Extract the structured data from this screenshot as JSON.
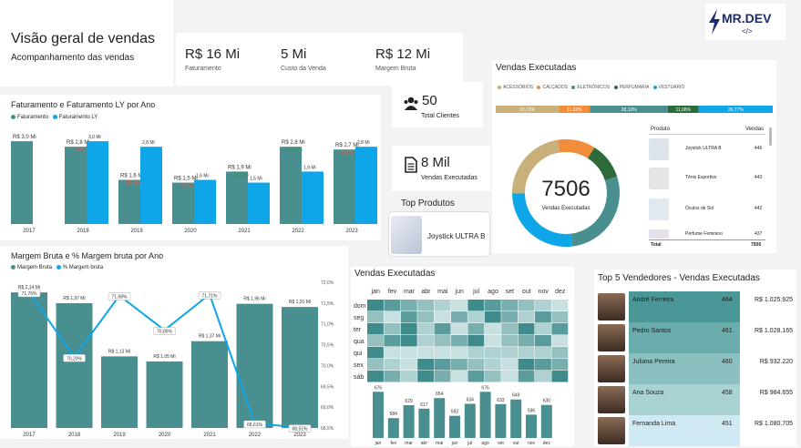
{
  "header": {
    "title": "Visão geral de vendas",
    "subtitle": "Acompanhamento das vendas",
    "logo_text": "MR.DEV",
    "logo_sub": "</>"
  },
  "kpis": [
    {
      "value": "R$ 16 Mi",
      "label": "Faturamento"
    },
    {
      "value": "5 Mi",
      "label": "Custo da Venda"
    },
    {
      "value": "R$ 12 Mi",
      "label": "Margem Bruta"
    }
  ],
  "clients": {
    "value": "50",
    "label": "Total Clientes",
    "icon": "people-icon"
  },
  "sales_kpi": {
    "value": "8 Mil",
    "label": "Vendas Executadas",
    "icon": "document-icon"
  },
  "top_product": {
    "title": "Top Produtos",
    "name": "Joystick ULTRA B"
  },
  "colors": {
    "teal": "#4a8f8f",
    "blue": "#0ea5e9",
    "red": "#e05a47",
    "green": "#2e9e4f",
    "tan": "#c9b07a",
    "orange": "#f18d3b",
    "darkgreen": "#2e6b3a",
    "cyan": "#17a2d6"
  },
  "revenue_chart": {
    "title": "Faturamento e Faturamento LY por Ano",
    "legend": [
      "Faturamento",
      "Faturamento LY"
    ],
    "chart_data": {
      "type": "bar",
      "categories": [
        "2017",
        "2018",
        "2019",
        "2020",
        "2021",
        "2022",
        "2023"
      ],
      "series": [
        {
          "name": "Faturamento",
          "values": [
            3.0,
            2.8,
            1.6,
            1.5,
            1.9,
            2.8,
            2.7
          ],
          "labels": [
            "R$ 3,0 Mi",
            "R$ 2,8 Mi",
            "R$ 1,6 Mi",
            "R$ 1,5 Mi",
            "R$ 1,9 Mi",
            "R$ 2,8 Mi",
            "R$ 2,7 Mi"
          ]
        },
        {
          "name": "Faturamento LY",
          "values": [
            null,
            3.0,
            2.8,
            1.6,
            1.5,
            1.9,
            2.8
          ],
          "labels": [
            "",
            "3,0 Mi",
            "2,8 Mi",
            "1,6 Mi",
            "1,5 Mi",
            "1,9 Mi",
            "2,8 Mi"
          ]
        }
      ],
      "pct_labels": [
        "",
        "6,6%",
        "45,9%",
        "5,6%",
        "28,1%",
        "47,4%",
        "2,1%"
      ],
      "pct_colors": [
        "",
        "#e05a47",
        "#e05a47",
        "#e05a47",
        "#2e9e4f",
        "#2e9e4f",
        "#e05a47"
      ],
      "ylim": [
        0,
        3.3
      ]
    }
  },
  "margin_chart": {
    "title": "Margem Bruta e % Margem bruta por Ano",
    "legend": [
      "Margem Bruta",
      "% Margem bruta"
    ],
    "chart_data": {
      "type": "bar",
      "categories": [
        "2017",
        "2018",
        "2019",
        "2020",
        "2021",
        "2022",
        "2023"
      ],
      "series": [
        {
          "name": "Margem Bruta",
          "values": [
            2.14,
            1.97,
            1.13,
            1.05,
            1.37,
            1.96,
            1.91
          ],
          "labels": [
            "R$ 2,14 Mi",
            "R$ 1,97 Mi",
            "R$ 1,13 Mi",
            "R$ 1,05 Mi",
            "R$ 1,37 Mi",
            "R$ 1,96 Mi",
            "R$ 1,91 Mi"
          ]
        },
        {
          "name": "% Margem bruta",
          "values": [
            71.76,
            70.2,
            71.68,
            70.85,
            71.71,
            68.61,
            68.51
          ],
          "labels": [
            "71,76%",
            "70,20%",
            "71,68%",
            "70,85%",
            "71,71%",
            "68,61%",
            "68,51%"
          ]
        }
      ],
      "y2_ticks": [
        "72,0%",
        "71,5%",
        "71,0%",
        "70,5%",
        "70,0%",
        "69,5%",
        "69,0%",
        "68,5%"
      ],
      "y2lim": [
        68.5,
        72.0
      ],
      "ylim": [
        0,
        2.3
      ]
    }
  },
  "donut": {
    "title": "Vendas Executadas",
    "center_value": "7506",
    "center_label": "Vendas Executadas",
    "legend": [
      "ACESSÓRIOS",
      "CALÇADOS",
      "ELETRÔNICOS",
      "PERFUMARIA",
      "VESTUÁRIO"
    ],
    "chart_data": {
      "type": "pie",
      "categories": [
        "ACESSÓRIOS",
        "CALÇADOS",
        "ELETRÔNICOS",
        "PERFUMARIA",
        "VESTUÁRIO"
      ],
      "values": [
        22.73,
        11.32,
        28.1,
        11.08,
        26.77
      ],
      "labels": [
        "22,73%",
        "11,32%",
        "28,10%",
        "11,08%",
        "26,77%"
      ],
      "colors": [
        "#c9b07a",
        "#f18d3b",
        "#4a8f8f",
        "#2e6b3a",
        "#0ea5e9"
      ]
    },
    "table": {
      "headers": [
        "Produto",
        "Vendas"
      ],
      "rows": [
        {
          "name": "Joystick ULTRA B",
          "value": "446"
        },
        {
          "name": "Tênis Esportivo",
          "value": "443"
        },
        {
          "name": "Óculos de Sol",
          "value": "442"
        },
        {
          "name": "Perfume Feminino",
          "value": "437"
        }
      ],
      "total_label": "Total",
      "total_value": "7506"
    }
  },
  "heatmap": {
    "title": "Vendas Executadas",
    "months": [
      "jan",
      "fev",
      "mar",
      "abr",
      "mai",
      "jun",
      "jul",
      "ago",
      "set",
      "out",
      "nov",
      "dez"
    ],
    "days": [
      "dom",
      "seg",
      "ter",
      "qua",
      "qui",
      "sex",
      "sáb"
    ],
    "chart_data": {
      "type": "bar",
      "categories": [
        "jan",
        "fev",
        "mar",
        "abr",
        "mai",
        "jun",
        "jul",
        "ago",
        "set",
        "out",
        "nov",
        "dez"
      ],
      "values": [
        676,
        584,
        629,
        617,
        654,
        592,
        634,
        676,
        633,
        649,
        596,
        630
      ]
    }
  },
  "sellers": {
    "title": "Top 5 Vendedores - Vendas Executadas",
    "rows": [
      {
        "name": "André Ferreira",
        "sales": "464",
        "value": "R$ 1.025.925"
      },
      {
        "name": "Pedro Santos",
        "sales": "461",
        "value": "R$ 1.028.165"
      },
      {
        "name": "Juliana Pereira",
        "sales": "460",
        "value": "R$ 932.220"
      },
      {
        "name": "Ana Souza",
        "sales": "458",
        "value": "R$ 984.655"
      },
      {
        "name": "Fernanda Lima",
        "sales": "451",
        "value": "R$ 1.080.705"
      }
    ]
  }
}
